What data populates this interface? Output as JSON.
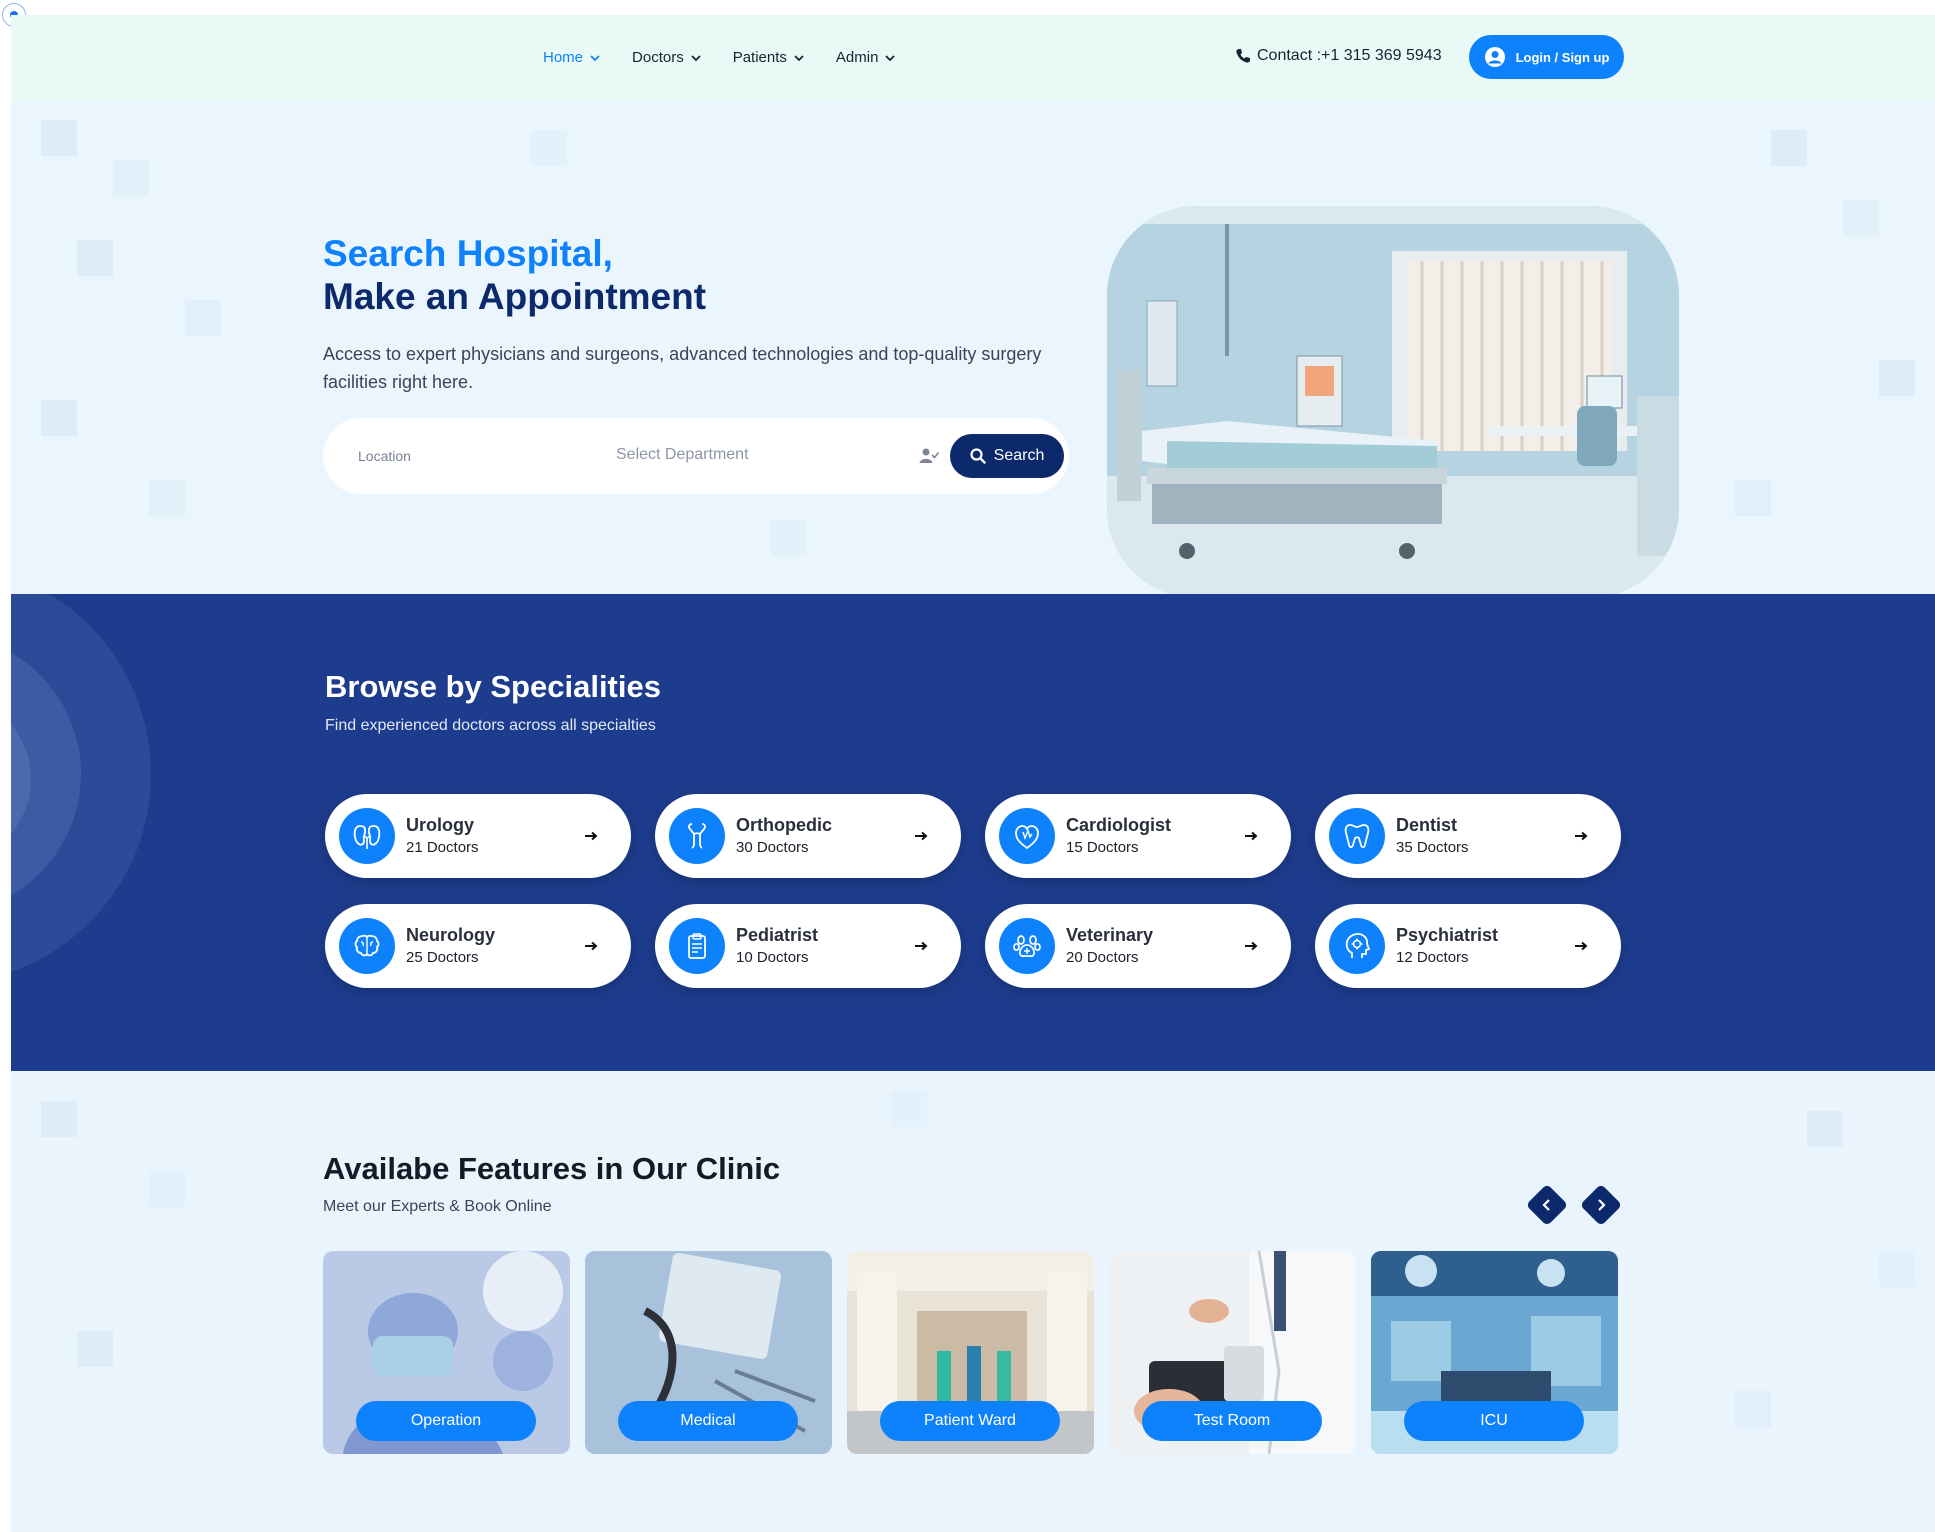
{
  "nav": {
    "items": [
      {
        "label": "Home",
        "active": true
      },
      {
        "label": "Doctors",
        "active": false
      },
      {
        "label": "Patients",
        "active": false
      },
      {
        "label": "Admin",
        "active": false
      }
    ],
    "contact": "Contact :+1 315 369 5943",
    "login_label": "Login / Sign up"
  },
  "hero": {
    "title_line1": "Search Hospital,",
    "title_line2": "Make an Appointment",
    "description": "Access to expert physicians and surgeons, advanced technologies and top-quality surgery facilities right here.",
    "search": {
      "location_placeholder": "Location",
      "department_placeholder": "Select Department",
      "button_label": "Search"
    }
  },
  "specialities": {
    "title": "Browse by Specialities",
    "subtitle": "Find experienced doctors across all specialties",
    "items": [
      {
        "name": "Urology",
        "count": "21 Doctors",
        "icon": "kidney-icon"
      },
      {
        "name": "Orthopedic",
        "count": "30 Doctors",
        "icon": "bone-icon"
      },
      {
        "name": "Cardiologist",
        "count": "15 Doctors",
        "icon": "heart-icon"
      },
      {
        "name": "Dentist",
        "count": "35 Doctors",
        "icon": "tooth-icon"
      },
      {
        "name": "Neurology",
        "count": "25 Doctors",
        "icon": "brain-icon"
      },
      {
        "name": "Pediatrist",
        "count": "10 Doctors",
        "icon": "clipboard-icon"
      },
      {
        "name": "Veterinary",
        "count": "20 Doctors",
        "icon": "paw-icon"
      },
      {
        "name": "Psychiatrist",
        "count": "12 Doctors",
        "icon": "head-gear-icon"
      }
    ]
  },
  "features": {
    "title": "Availabe Features in Our Clinic",
    "subtitle": "Meet our Experts & Book Online",
    "items": [
      {
        "label": "Operation"
      },
      {
        "label": "Medical"
      },
      {
        "label": "Patient Ward"
      },
      {
        "label": "Test Room"
      },
      {
        "label": "ICU"
      }
    ]
  },
  "colors": {
    "primary": "#0e82fd",
    "navy": "#0c2a6b",
    "specialities_bg": "#1d3c8d",
    "header_bg": "#e8f9f6",
    "hero_bg": "#eaf5fd"
  }
}
